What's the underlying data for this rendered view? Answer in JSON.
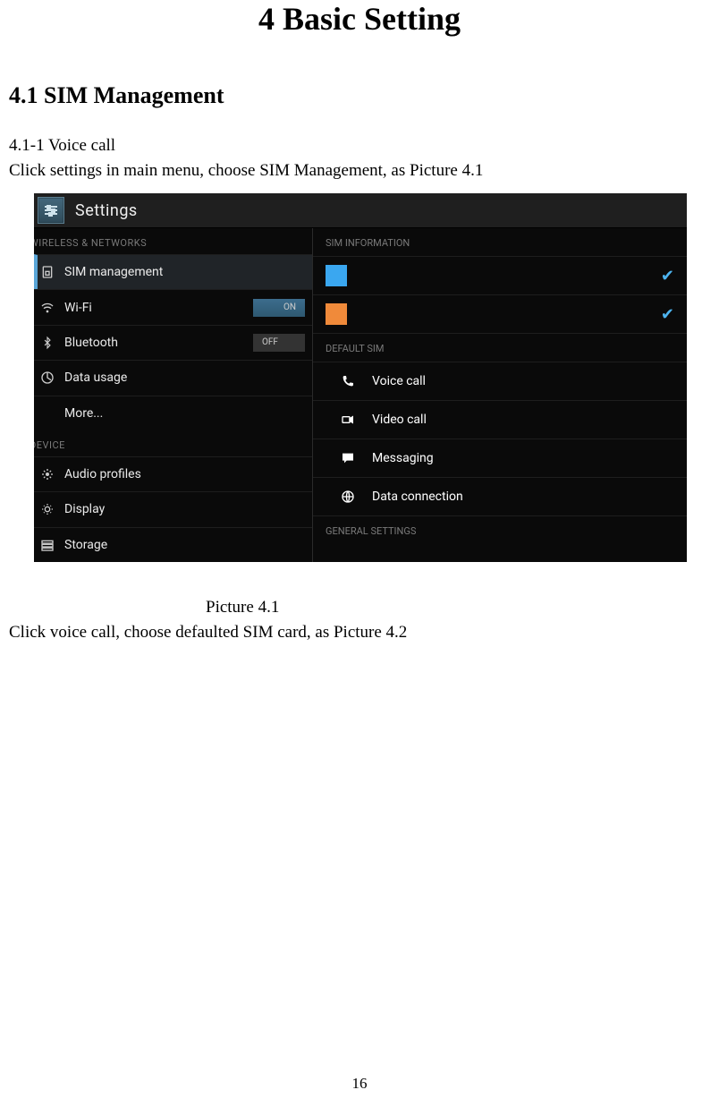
{
  "doc": {
    "chapter_title": "4 Basic Setting",
    "section_title": "4.1 SIM Management",
    "subsection": "4.1-1 Voice call",
    "intro_text": "Click settings in main menu, choose SIM Management, as Picture 4.1",
    "caption": "Picture 4.1",
    "followup_text": "Click voice call, choose defaulted SIM card, as Picture 4.2",
    "page_number": "16"
  },
  "screenshot": {
    "header_title": "Settings",
    "left": {
      "header_wireless": "WIRELESS & NETWORKS",
      "items": [
        {
          "label": "SIM management"
        },
        {
          "label": "Wi-Fi",
          "toggle": "ON"
        },
        {
          "label": "Bluetooth",
          "toggle": "OFF"
        },
        {
          "label": "Data usage"
        },
        {
          "label": "More..."
        }
      ],
      "header_device": "DEVICE",
      "device_items": [
        {
          "label": "Audio profiles"
        },
        {
          "label": "Display"
        },
        {
          "label": "Storage"
        }
      ]
    },
    "right": {
      "header_sim_info": "SIM INFORMATION",
      "sims": [
        {
          "badge": "",
          "color": "blue",
          "checked": true
        },
        {
          "badge": "",
          "color": "orange",
          "checked": true
        }
      ],
      "header_default": "DEFAULT SIM",
      "defaults": [
        {
          "label": "Voice call"
        },
        {
          "label": "Video call"
        },
        {
          "label": "Messaging"
        },
        {
          "label": "Data connection"
        }
      ],
      "header_general": "GENERAL SETTINGS"
    }
  }
}
